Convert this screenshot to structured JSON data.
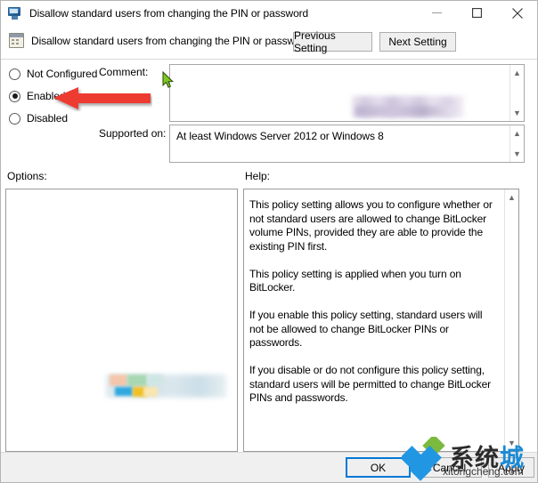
{
  "window": {
    "title": "Disallow standard users from changing the PIN or password",
    "title_icon": "monitor-icon",
    "controls": {
      "minimize": "minimize-icon",
      "maximize": "maximize-icon",
      "close": "close-icon"
    }
  },
  "header": {
    "icon": "policy-setting-icon",
    "title": "Disallow standard users from changing the PIN or password",
    "previous_button": "Previous Setting",
    "next_button": "Next Setting"
  },
  "state_options": [
    {
      "label": "Not Configured",
      "selected": false
    },
    {
      "label": "Enabled",
      "selected": true
    },
    {
      "label": "Disabled",
      "selected": false
    }
  ],
  "fields": {
    "comment_label": "Comment:",
    "comment_value": "",
    "supported_label": "Supported on:",
    "supported_value": "At least Windows Server 2012 or Windows 8"
  },
  "panels": {
    "options_label": "Options:",
    "options_value": "",
    "help_label": "Help:",
    "help_text": "This policy setting allows you to configure whether or not standard users are allowed to change BitLocker volume PINs, provided they are able to provide the existing PIN first.\n\nThis policy setting is applied when you turn on BitLocker.\n\nIf you enable this policy setting, standard users will not be allowed to change BitLocker PINs or passwords.\n\nIf you disable or do not configure this policy setting, standard users will be permitted to change BitLocker PINs and passwords."
  },
  "footer": {
    "ok": "OK",
    "cancel": "Cancel",
    "apply": "Apply"
  },
  "annotations": {
    "red_arrow": "red-arrow-pointing-to-enabled",
    "cursor": "mouse-cursor"
  },
  "watermark": {
    "brand_cn_dark": "系统",
    "brand_cn_blue": "城",
    "url": "xitongcheng.com",
    "logo": "diamond-logo"
  },
  "colors": {
    "accent": "#0078d7",
    "arrow": "#ee3b33",
    "watermark_blue": "#1a8ad6",
    "window_bg": "#ffffff",
    "footer_bg": "#f0f0f0"
  }
}
